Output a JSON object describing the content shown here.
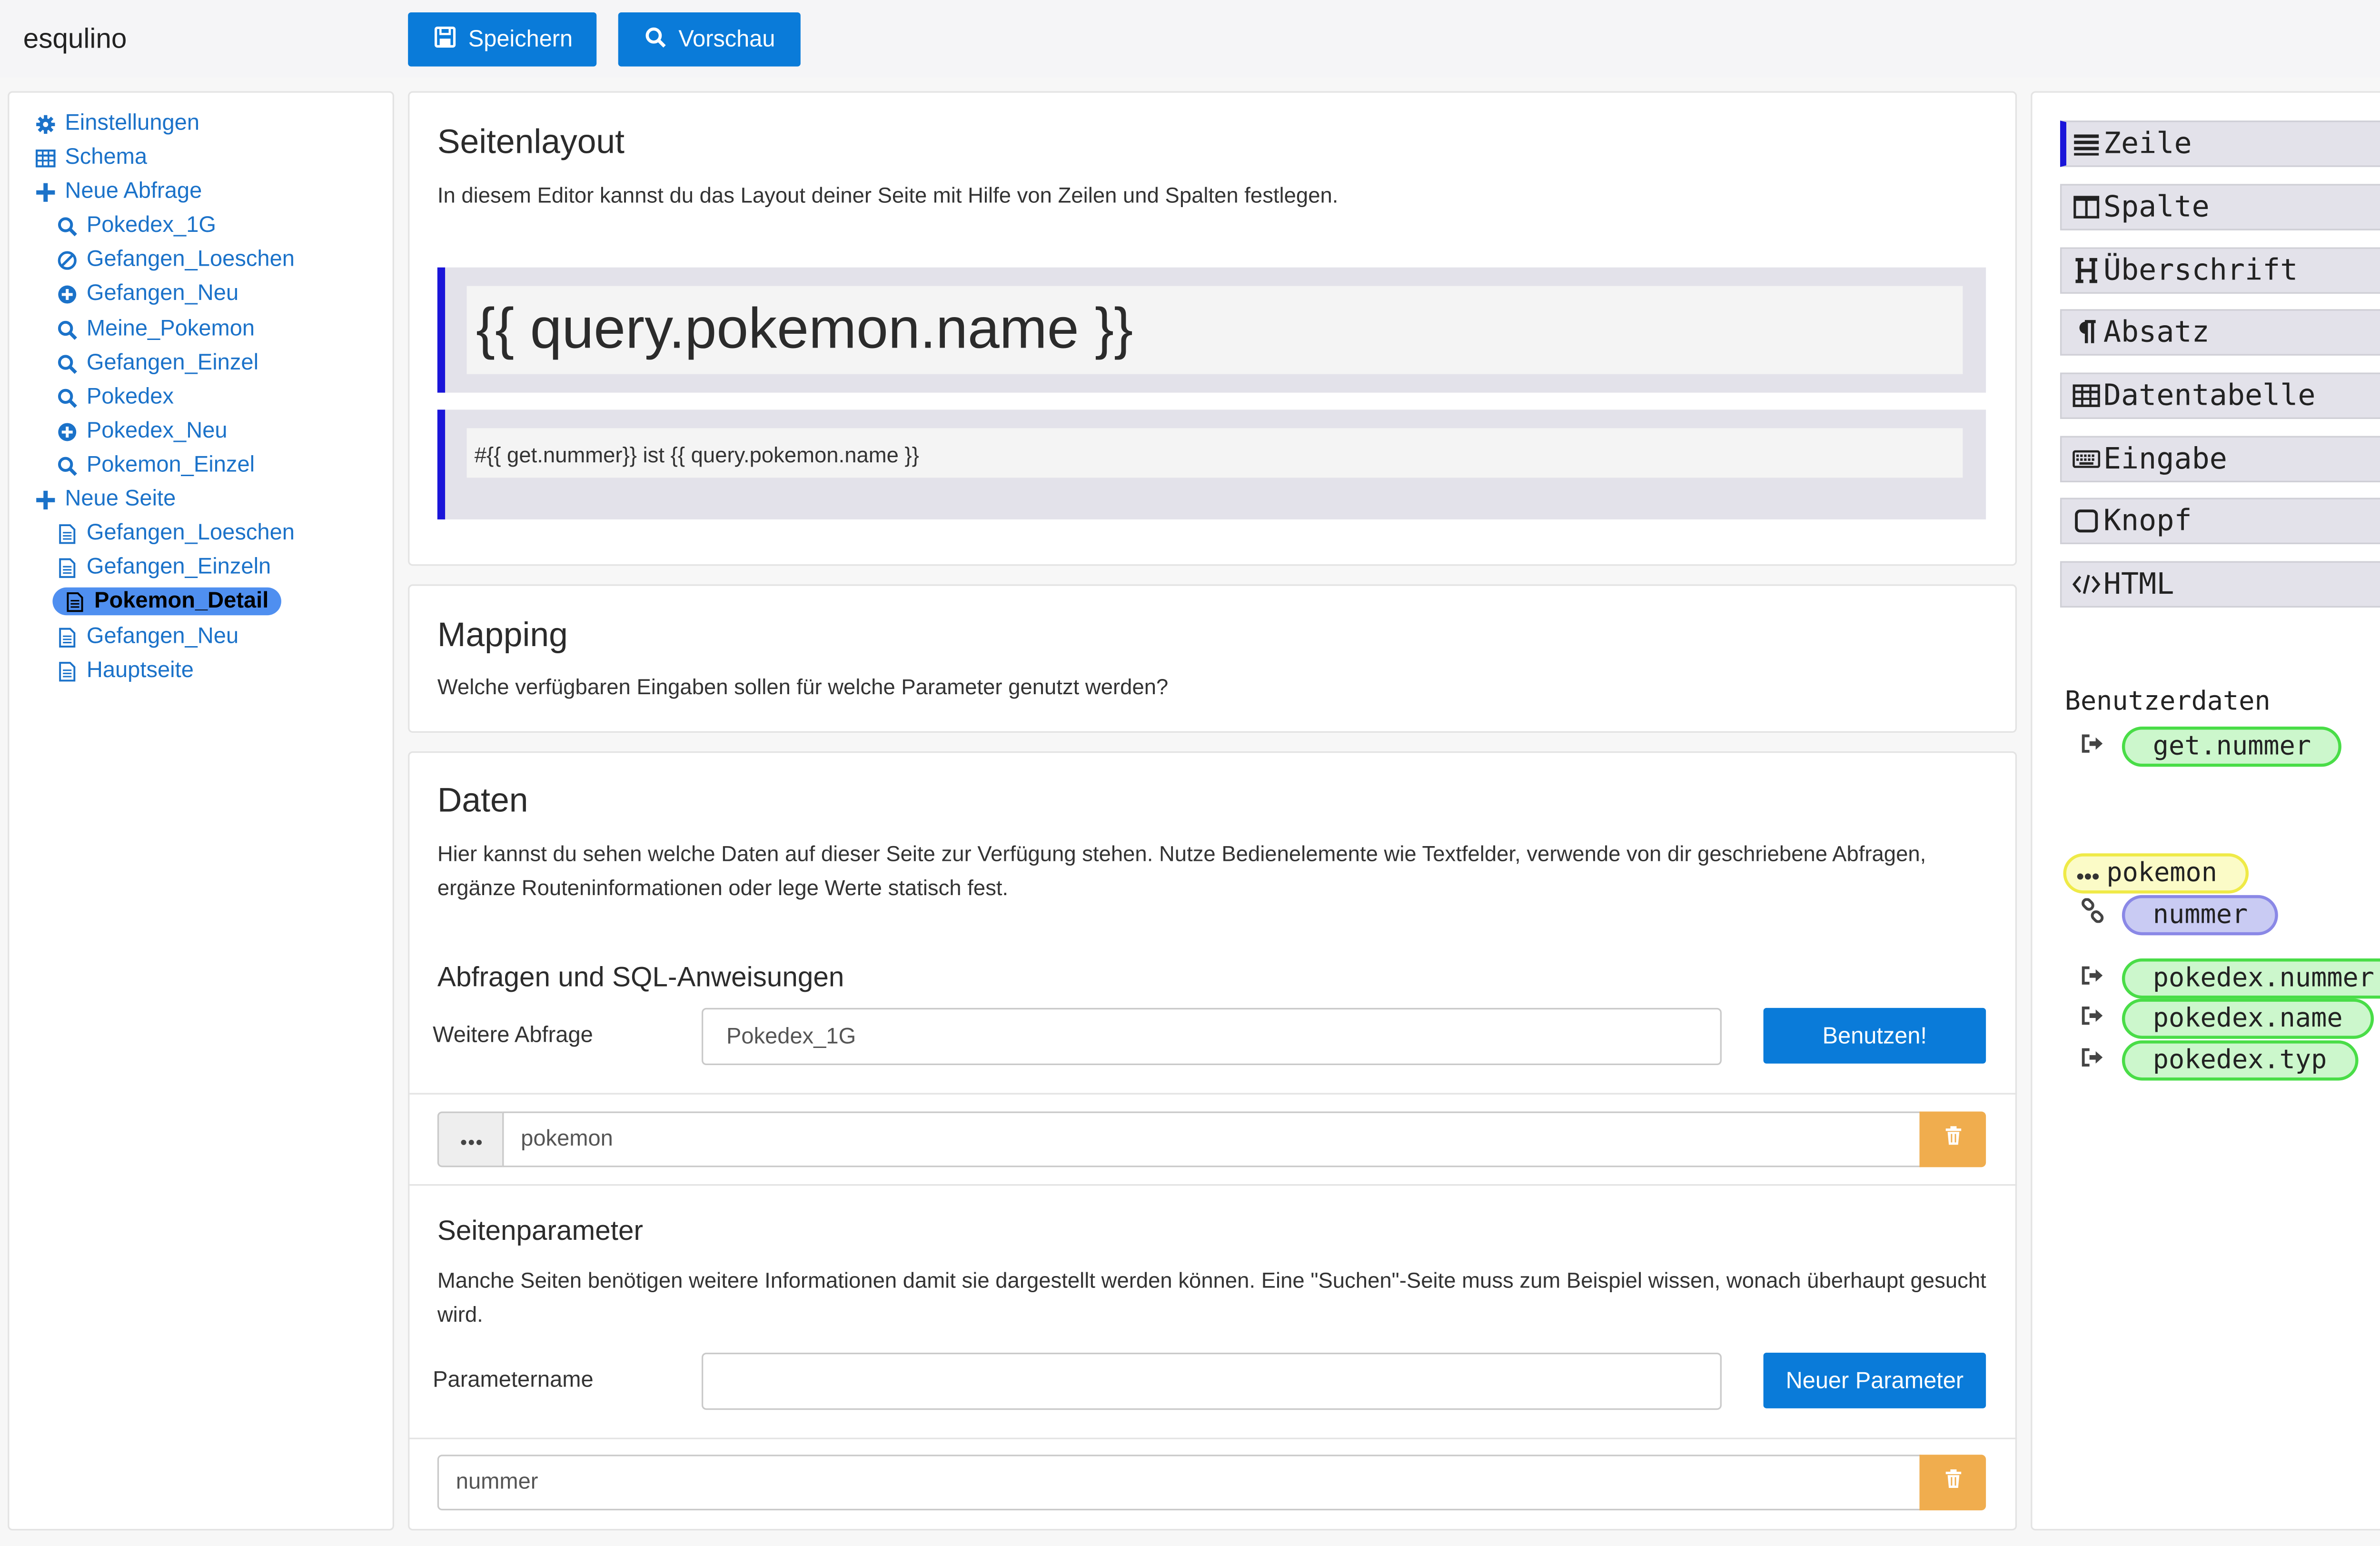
{
  "app": {
    "title": "esqulino"
  },
  "toolbar": {
    "save_label": "Speichern",
    "preview_label": "Vorschau"
  },
  "sidebar": {
    "items": [
      {
        "label": "Einstellungen",
        "icon": "gear-icon"
      },
      {
        "label": "Schema",
        "icon": "table-icon"
      },
      {
        "label": "Neue Abfrage",
        "icon": "plus-icon"
      },
      {
        "label": "Pokedex_1G",
        "icon": "search-icon"
      },
      {
        "label": "Gefangen_Loeschen",
        "icon": "ban-icon"
      },
      {
        "label": "Gefangen_Neu",
        "icon": "plus-circle-icon"
      },
      {
        "label": "Meine_Pokemon",
        "icon": "search-icon"
      },
      {
        "label": "Gefangen_Einzel",
        "icon": "search-icon"
      },
      {
        "label": "Pokedex",
        "icon": "search-icon"
      },
      {
        "label": "Pokedex_Neu",
        "icon": "plus-circle-icon"
      },
      {
        "label": "Pokemon_Einzel",
        "icon": "search-icon"
      },
      {
        "label": "Neue Seite",
        "icon": "plus-icon"
      },
      {
        "label": "Gefangen_Loeschen",
        "icon": "file-icon"
      },
      {
        "label": "Gefangen_Einzeln",
        "icon": "file-icon"
      },
      {
        "label": "Pokemon_Detail",
        "icon": "file-icon",
        "active": true
      },
      {
        "label": "Gefangen_Neu",
        "icon": "file-icon"
      },
      {
        "label": "Hauptseite",
        "icon": "file-icon"
      }
    ]
  },
  "layout_section": {
    "title": "Seitenlayout",
    "description": "In diesem Editor kannst du das Layout deiner Seite mit Hilfe von Zeilen und Spalten festlegen.",
    "heading_text": "{{ query.pokemon.name }}",
    "paragraph_text": "#{{ get.nummer}} ist {{ query.pokemon.name }}"
  },
  "mapping_section": {
    "title": "Mapping",
    "description": "Welche verfügbaren Eingaben sollen für welche Parameter genutzt werden?"
  },
  "data_section": {
    "title": "Daten",
    "description": "Hier kannst du sehen welche Daten auf dieser Seite zur Verfügung stehen. Nutze Bedienelemente wie Textfelder, verwende von dir geschriebene Abfragen, ergänze Routeninformationen oder lege Werte statisch fest.",
    "queries_title": "Abfragen und SQL-Anweisungen",
    "more_query_label": "Weitere Abfrage",
    "more_query_value": "Pokedex_1G",
    "use_button": "Benutzen!",
    "query_entry_value": "pokemon",
    "params_title": "Seitenparameter",
    "params_description": "Manche Seiten benötigen weitere Informationen damit sie dargestellt werden können. Eine \"Suchen\"-Seite muss zum Beispiel wissen, wonach überhaupt gesucht wird.",
    "param_name_label": "Parametername",
    "param_name_value": "",
    "new_param_button": "Neuer Parameter",
    "param_entry_value": "nummer"
  },
  "palette": {
    "items": [
      {
        "label": "Zeile",
        "icon": "rows-icon"
      },
      {
        "label": "Spalte",
        "icon": "columns-icon"
      },
      {
        "label": "Überschrift",
        "icon": "heading-icon"
      },
      {
        "label": "Absatz",
        "icon": "paragraph-icon"
      },
      {
        "label": "Datentabelle",
        "icon": "table-icon"
      },
      {
        "label": "Eingabe",
        "icon": "keyboard-icon"
      },
      {
        "label": "Knopf",
        "icon": "square-icon"
      },
      {
        "label": "HTML",
        "icon": "code-icon"
      }
    ]
  },
  "user_data": {
    "title": "Benutzerdaten",
    "get_param": "get.nummer",
    "query_name": "pokemon",
    "query_param": "nummer",
    "columns": [
      "pokedex.nummer",
      "pokedex.name",
      "pokedex.typ"
    ]
  },
  "colors": {
    "primary": "#0a7bd9",
    "warning": "#f0ad4e",
    "active_bar": "#1a15d9",
    "pill_green_border": "#49dd47",
    "pill_blue_border": "#8a88e6",
    "pill_yellow_border": "#efea47"
  }
}
